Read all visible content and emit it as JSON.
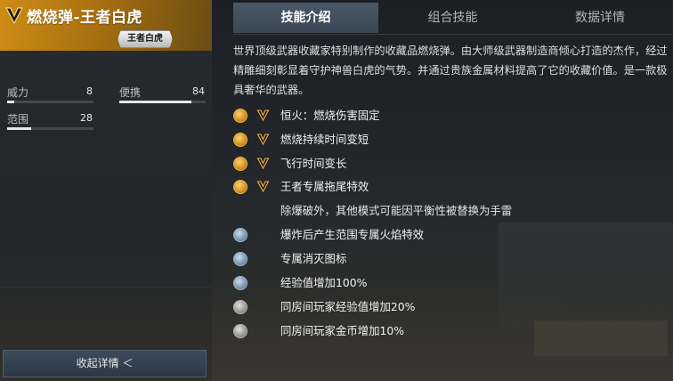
{
  "weapon": {
    "name": "燃烧弹-王者白虎",
    "rank_badge": "王者白虎"
  },
  "stats": [
    {
      "label": "威力",
      "value": "8",
      "fraction": 0.08
    },
    {
      "label": "便携",
      "value": "84",
      "fraction": 0.84
    },
    {
      "label": "范围",
      "value": "28",
      "fraction": 0.28
    }
  ],
  "tabs": [
    {
      "label": "技能介绍",
      "active": true
    },
    {
      "label": "组合技能",
      "active": false
    },
    {
      "label": "数据详情",
      "active": false
    }
  ],
  "description": "世界顶级武器收藏家特别制作的收藏品燃烧弹。由大师级武器制造商倾心打造的杰作，经过精雕细刻彰显着守护神兽白虎的气势。并通过贵族金属材料提高了它的收藏价值。是一款极具奢华的武器。",
  "skills": [
    {
      "text": "恒火：燃烧伤害固定",
      "icon": "fire-constant-icon",
      "tier": "gold",
      "v_badge": true
    },
    {
      "text": "燃烧持续时间变短",
      "icon": "burn-duration-icon",
      "tier": "gold",
      "v_badge": true
    },
    {
      "text": "飞行时间变长",
      "icon": "flight-time-icon",
      "tier": "gold",
      "v_badge": true
    },
    {
      "text": "王者专属拖尾特效",
      "icon": "trail-effect-icon",
      "tier": "gold",
      "v_badge": true
    },
    {
      "text": "除爆破外，其他模式可能因平衡性被替换为手雷",
      "icon": "",
      "tier": "note",
      "v_badge": false
    },
    {
      "text": "爆炸后产生范围专属火焰特效",
      "icon": "flame-effect-icon",
      "tier": "blue",
      "v_badge": false
    },
    {
      "text": "专属消灭图标",
      "icon": "kill-icon",
      "tier": "blue",
      "v_badge": false
    },
    {
      "text": "经验值增加100%",
      "icon": "exp-bonus-icon",
      "tier": "blue",
      "v_badge": false
    },
    {
      "text": "同房间玩家经验值增加20%",
      "icon": "room-exp-icon",
      "tier": "grey",
      "v_badge": false
    },
    {
      "text": "同房间玩家金币增加10%",
      "icon": "room-coin-icon",
      "tier": "grey",
      "v_badge": false
    }
  ],
  "collapse_button": {
    "label": "收起详情 ＜"
  },
  "colors": {
    "gold": "#cf8d17",
    "tab_active": "#4a5968",
    "panel": "#23272c"
  }
}
